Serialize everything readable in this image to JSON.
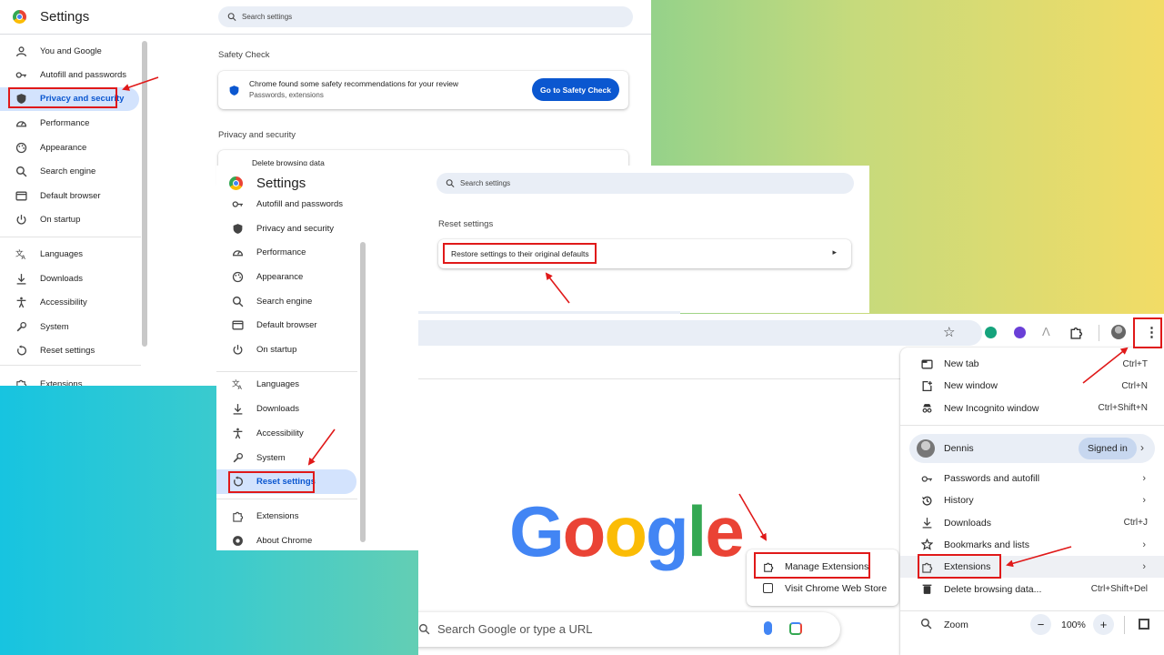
{
  "app_icon": "chrome-logo-icon",
  "panel1": {
    "title": "Settings",
    "search_placeholder": "Search settings",
    "sidebar": [
      {
        "label": "You and Google",
        "icon": "person-icon"
      },
      {
        "label": "Autofill and passwords",
        "icon": "key-icon"
      },
      {
        "label": "Privacy and security",
        "icon": "shield-icon"
      },
      {
        "label": "Performance",
        "icon": "gauge-icon"
      },
      {
        "label": "Appearance",
        "icon": "palette-icon"
      },
      {
        "label": "Search engine",
        "icon": "search-icon"
      },
      {
        "label": "Default browser",
        "icon": "browser-icon"
      },
      {
        "label": "On startup",
        "icon": "power-icon"
      },
      {
        "label": "Languages",
        "icon": "translate-icon"
      },
      {
        "label": "Downloads",
        "icon": "download-icon"
      },
      {
        "label": "Accessibility",
        "icon": "accessibility-icon"
      },
      {
        "label": "System",
        "icon": "wrench-icon"
      },
      {
        "label": "Reset settings",
        "icon": "reset-icon"
      },
      {
        "label": "Extensions",
        "icon": "puzzle-icon"
      }
    ],
    "safety_heading": "Safety Check",
    "safety_text": "Chrome found some safety recommendations for your review",
    "safety_sub": "Passwords, extensions",
    "safety_button": "Go to Safety Check",
    "privacy_heading": "Privacy and security",
    "privacy_first_item": "Delete browsing data"
  },
  "panel2": {
    "title": "Settings",
    "search_placeholder": "Search settings",
    "sidebar": [
      {
        "label": "Autofill and passwords",
        "icon": "key-icon"
      },
      {
        "label": "Privacy and security",
        "icon": "shield-icon"
      },
      {
        "label": "Performance",
        "icon": "gauge-icon"
      },
      {
        "label": "Appearance",
        "icon": "palette-icon"
      },
      {
        "label": "Search engine",
        "icon": "search-icon"
      },
      {
        "label": "Default browser",
        "icon": "browser-icon"
      },
      {
        "label": "On startup",
        "icon": "power-icon"
      },
      {
        "label": "Languages",
        "icon": "translate-icon"
      },
      {
        "label": "Downloads",
        "icon": "download-icon"
      },
      {
        "label": "Accessibility",
        "icon": "accessibility-icon"
      },
      {
        "label": "System",
        "icon": "wrench-icon"
      },
      {
        "label": "Reset settings",
        "icon": "reset-icon"
      },
      {
        "label": "Extensions",
        "icon": "puzzle-icon"
      },
      {
        "label": "About Chrome",
        "icon": "chrome-icon"
      }
    ],
    "reset_heading": "Reset settings",
    "restore_label": "Restore settings to their original defaults"
  },
  "newtab": {
    "logo": [
      "G",
      "o",
      "o",
      "g",
      "l",
      "e"
    ],
    "logo_colors": [
      "#4285f4",
      "#ea4335",
      "#fbbc05",
      "#4285f4",
      "#34a853",
      "#ea4335"
    ],
    "search_placeholder": "Search Google or type a URL"
  },
  "ext_submenu": {
    "items": [
      {
        "label": "Manage Extensions",
        "icon": "puzzle-icon"
      },
      {
        "label": "Visit Chrome Web Store",
        "icon": "store-icon"
      }
    ]
  },
  "chrome_menu": {
    "items_top": [
      {
        "label": "New tab",
        "shortcut": "Ctrl+T",
        "icon": "new-tab-icon"
      },
      {
        "label": "New window",
        "shortcut": "Ctrl+N",
        "icon": "new-window-icon"
      },
      {
        "label": "New Incognito window",
        "shortcut": "Ctrl+Shift+N",
        "icon": "incognito-icon"
      }
    ],
    "profile_name": "Dennis",
    "profile_status": "Signed in",
    "items_mid": [
      {
        "label": "Passwords and autofill",
        "shortcut": "",
        "icon": "key-icon",
        "submenu": true
      },
      {
        "label": "History",
        "shortcut": "",
        "icon": "history-icon",
        "submenu": true
      },
      {
        "label": "Downloads",
        "shortcut": "Ctrl+J",
        "icon": "download-icon",
        "submenu": false
      },
      {
        "label": "Bookmarks and lists",
        "shortcut": "",
        "icon": "star-icon",
        "submenu": true
      },
      {
        "label": "Extensions",
        "shortcut": "",
        "icon": "puzzle-icon",
        "submenu": true
      },
      {
        "label": "Delete browsing data...",
        "shortcut": "Ctrl+Shift+Del",
        "icon": "trash-icon",
        "submenu": false
      }
    ],
    "zoom_label": "Zoom",
    "zoom_minus": "−",
    "zoom_value": "100%",
    "zoom_plus": "+"
  },
  "accent": "#0b57d0",
  "highlight_color": "#e01919"
}
